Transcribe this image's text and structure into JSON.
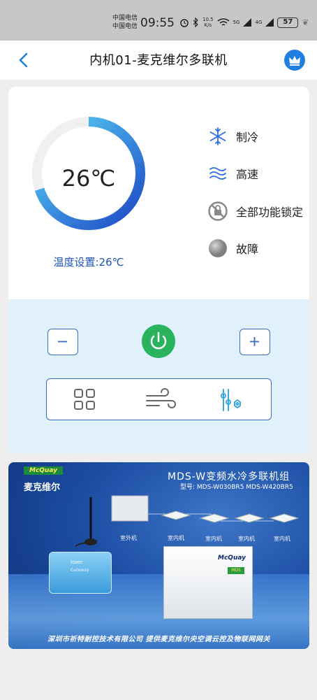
{
  "status_bar": {
    "carrier_1": "中国电信",
    "carrier_2": "中国电信",
    "time": "09:55",
    "net_speed_value": "10.5",
    "net_speed_unit": "K/s",
    "sim1_signal": "5G",
    "sim2_signal": "4G",
    "battery": "57"
  },
  "header": {
    "title": "内机01-麦克维尔多联机"
  },
  "thermostat": {
    "current_temp": "26℃",
    "setpoint_label": "温度设置:26℃",
    "ring_fill": 0.7,
    "ring_colors": [
      "#1d47c6",
      "#5ad8f7"
    ]
  },
  "status": {
    "items": [
      {
        "icon": "snowflake-icon",
        "label": "制冷"
      },
      {
        "icon": "wind-speed-icon",
        "label": "高速"
      },
      {
        "icon": "lock-disabled-icon",
        "label": "全部功能锁定"
      },
      {
        "icon": "fault-indicator-icon",
        "label": "故障"
      }
    ]
  },
  "controls": {
    "minus_icon": "minus-icon",
    "plus_icon": "plus-icon",
    "power_icon": "power-icon",
    "modes": [
      {
        "icon": "grid-apps-icon"
      },
      {
        "icon": "wind-mode-icon"
      },
      {
        "icon": "sliders-settings-icon"
      }
    ]
  },
  "banner": {
    "brand_en": "McQuay",
    "brand_cn": "麦克维尔",
    "title": "MDS-W变频水冷多联机组",
    "model": "型号: MDS-W030BR5  MDS-W420BR5",
    "outdoor_unit_label": "室外机",
    "indoor_unit_label": "室内机",
    "gateway_brand": "lozer",
    "gateway_label": "Gateway",
    "footer": "深圳市祈特耐控技术有限公司   提供麦克维尔央空调云控及物联网网关",
    "colors": {
      "primary": "#1c4ea4",
      "accent": "#1b8a3a"
    }
  },
  "colors": {
    "accent_blue": "#1f7fe0",
    "control_border": "#3a6fc0",
    "power_green": "#29b35d",
    "panel_light_blue": "#e0f1fc"
  }
}
